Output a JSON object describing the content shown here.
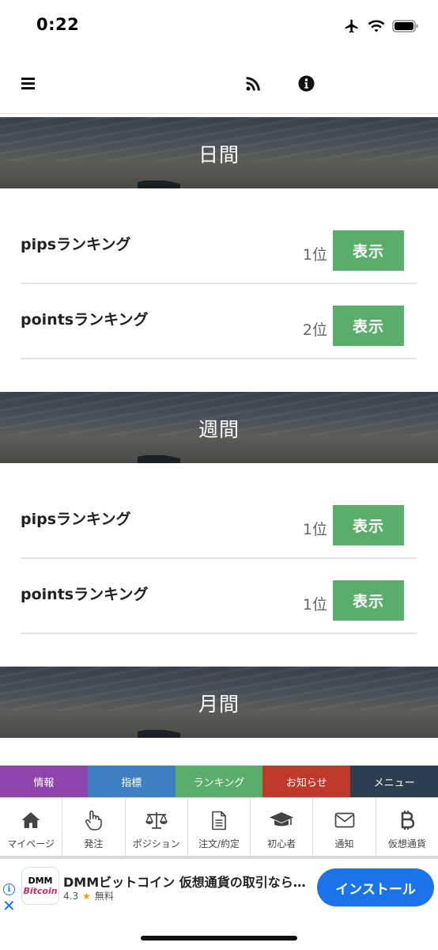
{
  "status_bar": {
    "time": "0:22"
  },
  "sections": [
    {
      "title": "日間",
      "rows": [
        {
          "label": "pipsランキング",
          "rank": "1位",
          "button": "表示"
        },
        {
          "label": "pointsランキング",
          "rank": "2位",
          "button": "表示"
        }
      ]
    },
    {
      "title": "週間",
      "rows": [
        {
          "label": "pipsランキング",
          "rank": "1位",
          "button": "表示"
        },
        {
          "label": "pointsランキング",
          "rank": "1位",
          "button": "表示"
        }
      ]
    },
    {
      "title": "月間"
    }
  ],
  "category_tabs": [
    {
      "label": "情報",
      "color": "#8e44ad"
    },
    {
      "label": "指標",
      "color": "#3d7fc1"
    },
    {
      "label": "ランキング",
      "color": "#5aad6a"
    },
    {
      "label": "お知らせ",
      "color": "#c0392b"
    },
    {
      "label": "メニュー",
      "color": "#2c3e50"
    }
  ],
  "bottom_nav": [
    {
      "label": "マイページ",
      "icon": "home-icon"
    },
    {
      "label": "発注",
      "icon": "hand-pointer-icon"
    },
    {
      "label": "ポジション",
      "icon": "balance-scale-icon"
    },
    {
      "label": "注文/約定",
      "icon": "document-icon"
    },
    {
      "label": "初心者",
      "icon": "graduation-cap-icon"
    },
    {
      "label": "通知",
      "icon": "envelope-icon"
    },
    {
      "label": "仮想通貨",
      "icon": "bitcoin-icon"
    }
  ],
  "ad": {
    "logo_top": "DMM",
    "logo_bottom": "Bitcoin",
    "title": "DMMビットコイン 仮想通貨の取引なら…",
    "rating": "4.3",
    "price": "無料",
    "install_label": "インストール"
  },
  "colors": {
    "show_button": "#5aad6a",
    "install_button": "#1a73e8"
  }
}
